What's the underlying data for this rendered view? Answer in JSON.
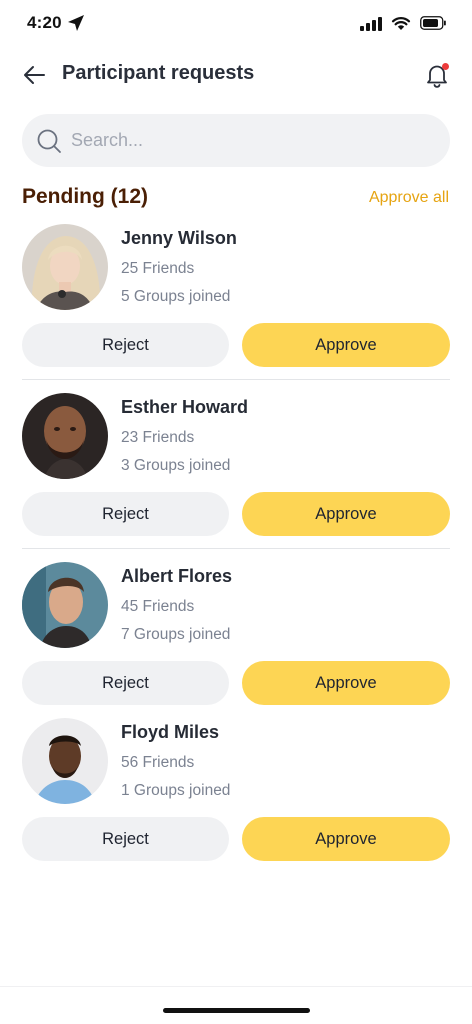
{
  "status_bar": {
    "time": "4:20"
  },
  "header": {
    "title": "Participant requests"
  },
  "search": {
    "placeholder": "Search..."
  },
  "section": {
    "title": "Pending (12)",
    "approve_all": "Approve all"
  },
  "buttons": {
    "reject": "Reject",
    "approve": "Approve"
  },
  "requests": [
    {
      "name": "Jenny Wilson",
      "friends": "25 Friends",
      "groups": "5 Groups joined"
    },
    {
      "name": "Esther Howard",
      "friends": "23 Friends",
      "groups": "3 Groups joined"
    },
    {
      "name": "Albert Flores",
      "friends": "45 Friends",
      "groups": "7 Groups joined"
    },
    {
      "name": "Floyd Miles",
      "friends": "56 Friends",
      "groups": "1 Groups joined"
    }
  ],
  "colors": {
    "accent": "#fdd554",
    "approve_all": "#e6a412",
    "section_title": "#4a1f05",
    "notification_dot": "#ec3b3b"
  }
}
